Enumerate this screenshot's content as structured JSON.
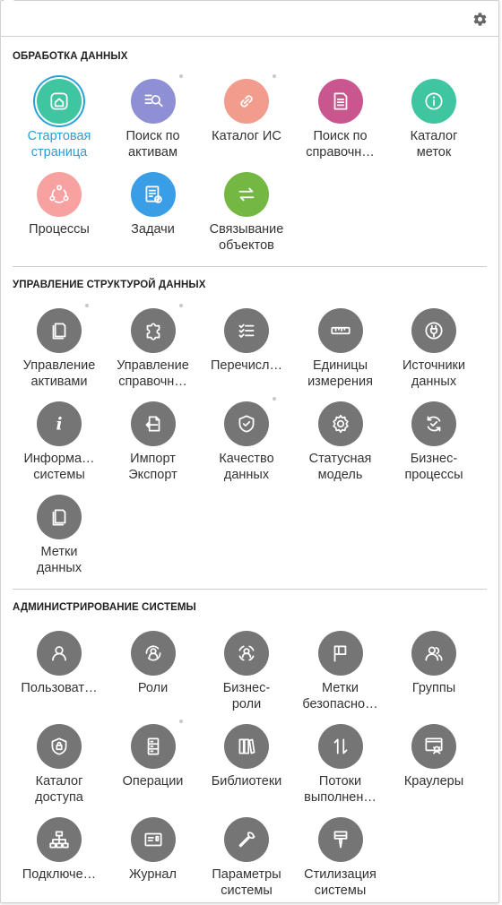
{
  "colors": {
    "active_label": "#2a9ed8",
    "active_ring": "#2aa0d8",
    "gray_icon": "#757575",
    "divider": "#cfcfcf"
  },
  "header": {
    "settings_icon": "gear-icon"
  },
  "sections": [
    {
      "title": "ОБРАБОТКА ДАННЫХ",
      "items": [
        {
          "l1": "Стартовая",
          "l2": "страница",
          "icon": "home-icon",
          "color": "#3fc6a0",
          "active": true,
          "dot": false
        },
        {
          "l1": "Поиск по",
          "l2": "активам",
          "icon": "search-icon",
          "color": "#8f8fd6",
          "dot": true
        },
        {
          "l1": "Каталог ИС",
          "l2": "",
          "icon": "link-icon",
          "color": "#f29c8d",
          "dot": true
        },
        {
          "l1": "Поиск по",
          "l2": "справочн…",
          "icon": "document-icon",
          "color": "#c9568f",
          "dot": false
        },
        {
          "l1": "Каталог",
          "l2": "меток",
          "icon": "info-icon",
          "color": "#3fc6a0",
          "dot": false
        },
        {
          "l1": "Процессы",
          "l2": "",
          "icon": "process-icon",
          "color": "#f7a2a0",
          "dot": false
        },
        {
          "l1": "Задачи",
          "l2": "",
          "icon": "tasks-icon",
          "color": "#3a9ee6",
          "dot": false
        },
        {
          "l1": "Связывание",
          "l2": "объектов",
          "icon": "exchange-icon",
          "color": "#74b843",
          "dot": false
        }
      ]
    },
    {
      "title": "УПРАВЛЕНИЕ СТРУКТУРОЙ ДАННЫХ",
      "items": [
        {
          "l1": "Управление",
          "l2": "активами",
          "icon": "files-icon",
          "color": "#757575",
          "dot": true
        },
        {
          "l1": "Управление",
          "l2": "справочн…",
          "icon": "puzzle-icon",
          "color": "#757575",
          "dot": true
        },
        {
          "l1": "Перечисл…",
          "l2": "",
          "icon": "checklist-icon",
          "color": "#757575",
          "dot": false
        },
        {
          "l1": "Единицы",
          "l2": "измерения",
          "icon": "ruler-icon",
          "color": "#757575",
          "dot": false
        },
        {
          "l1": "Источники",
          "l2": "данных",
          "icon": "plug-icon",
          "color": "#757575",
          "dot": false
        },
        {
          "l1": "Информа…",
          "l2": "системы",
          "icon": "italic-info-icon",
          "color": "#757575",
          "dot": false
        },
        {
          "l1": "Импорт",
          "l2": "Экспорт",
          "icon": "import-icon",
          "color": "#757575",
          "dot": false
        },
        {
          "l1": "Качество",
          "l2": "данных",
          "icon": "shield-check-icon",
          "color": "#757575",
          "dot": true
        },
        {
          "l1": "Статусная",
          "l2": "модель",
          "icon": "gear-icon",
          "color": "#757575",
          "dot": false
        },
        {
          "l1": "Бизнес-",
          "l2": "процессы",
          "icon": "cycle-check-icon",
          "color": "#757575",
          "dot": false
        },
        {
          "l1": "Метки",
          "l2": "данных",
          "icon": "files-icon",
          "color": "#757575",
          "dot": false
        }
      ]
    },
    {
      "title": "АДМИНИСТРИРОВАНИЕ СИСТЕМЫ",
      "items": [
        {
          "l1": "Пользоват…",
          "l2": "",
          "icon": "user-icon",
          "color": "#757575",
          "dot": false
        },
        {
          "l1": "Роли",
          "l2": "",
          "icon": "user-cycle-icon",
          "color": "#757575",
          "dot": false
        },
        {
          "l1": "Бизнес-",
          "l2": "роли",
          "icon": "user-target-icon",
          "color": "#757575",
          "dot": false
        },
        {
          "l1": "Метки",
          "l2": "безопасно…",
          "icon": "flag-icon",
          "color": "#757575",
          "dot": false
        },
        {
          "l1": "Группы",
          "l2": "",
          "icon": "users-icon",
          "color": "#757575",
          "dot": false
        },
        {
          "l1": "Каталог",
          "l2": "доступа",
          "icon": "lock-icon",
          "color": "#757575",
          "dot": false
        },
        {
          "l1": "Операции",
          "l2": "",
          "icon": "server-icon",
          "color": "#757575",
          "dot": true
        },
        {
          "l1": "Библиотеки",
          "l2": "",
          "icon": "books-icon",
          "color": "#757575",
          "dot": false
        },
        {
          "l1": "Потоки",
          "l2": "выполнен…",
          "icon": "swap-vertical-icon",
          "color": "#757575",
          "dot": false
        },
        {
          "l1": "Краулеры",
          "l2": "",
          "icon": "crawler-icon",
          "color": "#757575",
          "dot": false
        },
        {
          "l1": "Подключе…",
          "l2": "",
          "icon": "network-icon",
          "color": "#757575",
          "dot": false
        },
        {
          "l1": "Журнал",
          "l2": "",
          "icon": "journal-icon",
          "color": "#757575",
          "dot": false
        },
        {
          "l1": "Параметры",
          "l2": "системы",
          "icon": "wrench-icon",
          "color": "#757575",
          "dot": false
        },
        {
          "l1": "Стилизация",
          "l2": "системы",
          "icon": "brush-icon",
          "color": "#757575",
          "dot": false
        }
      ]
    }
  ]
}
